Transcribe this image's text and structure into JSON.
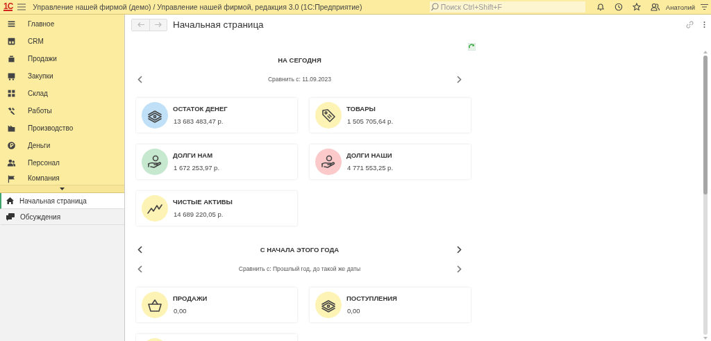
{
  "app": {
    "logo": "1С",
    "title": "Управление нашей фирмой (демо) / Управление нашей фирмой, редакция 3.0  (1С:Предприятие)",
    "search": {
      "placeholder": "Поиск Ctrl+Shift+F"
    },
    "user": "Анатолий"
  },
  "sidebar": {
    "sections": [
      {
        "label": "Главное"
      },
      {
        "label": "CRM"
      },
      {
        "label": "Продажи"
      },
      {
        "label": "Закупки"
      },
      {
        "label": "Склад"
      },
      {
        "label": "Работы"
      },
      {
        "label": "Производство"
      },
      {
        "label": "Деньги"
      },
      {
        "label": "Персонал"
      },
      {
        "label": "Компания"
      }
    ]
  },
  "open_windows": [
    {
      "label": "Начальная страница",
      "selected": true
    },
    {
      "label": "Обсуждения",
      "selected": false
    }
  ],
  "page": {
    "title": "Начальная страница"
  },
  "sections": [
    {
      "title": "НА СЕГОДНЯ",
      "period_arrows": false,
      "compare": "Сравнить с: 11.09.2023",
      "cards": [
        {
          "kind": "money",
          "color": "#bfe0f7",
          "title": "ОСТАТОК ДЕНЕГ",
          "value": "13 683 483,47 р."
        },
        {
          "kind": "tag",
          "color": "#fdf3b4",
          "title": "ТОВАРЫ",
          "value": "1 505 705,64 р."
        },
        {
          "kind": "hand",
          "color": "#c6e8cf",
          "title": "ДОЛГИ НАМ",
          "value": "1 672 253,97 р."
        },
        {
          "kind": "hand",
          "color": "#fbc9c9",
          "title": "ДОЛГИ НАШИ",
          "value": "4 771 553,25 р."
        },
        {
          "kind": "chart",
          "color": "#fdf3b4",
          "title": "ЧИСТЫЕ АКТИВЫ",
          "value": "14 689 220,05 р."
        }
      ]
    },
    {
      "title": "С НАЧАЛА ЭТОГО ГОДА",
      "period_arrows": true,
      "compare": "Сравнить с: Прошлый год, до такой же даты",
      "cards": [
        {
          "kind": "basket",
          "color": "#fdf3b4",
          "title": "ПРОДАЖИ",
          "value": "0,00"
        },
        {
          "kind": "money",
          "color": "#fdf3b4",
          "title": "ПОСТУПЛЕНИЯ",
          "value": "0,00"
        },
        {
          "kind": "partial",
          "color": "#fdf3b4"
        }
      ]
    }
  ]
}
